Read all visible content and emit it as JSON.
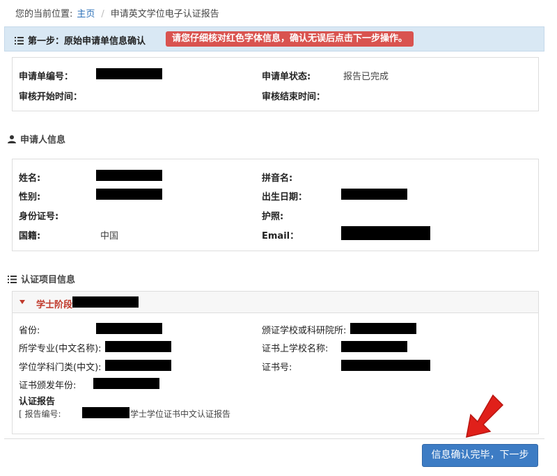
{
  "breadcrumb": {
    "prefix": "您的当前位置:",
    "home": "主页",
    "separator": "/",
    "current": "申请英文学位电子认证报告"
  },
  "step": {
    "title": "第一步：原始申请单信息确认",
    "warning": "请您仔细核对红色字体信息，确认无误后点击下一步操作。"
  },
  "application": {
    "number_label": "申请单编号：",
    "status_label": "申请单状态:",
    "status_value": "报告已完成",
    "review_start_label": "审核开始时间：",
    "review_end_label": "审核结束时间："
  },
  "applicant": {
    "section_title": "申请人信息",
    "name_label": "姓名:",
    "pinyin_label": "拼音名:",
    "gender_label": "性别:",
    "birth_label": "出生日期：",
    "id_label": "身份证号:",
    "passport_label": "护照:",
    "nationality_label": "国籍:",
    "nationality_value": "中国",
    "email_label": "Email："
  },
  "certification": {
    "section_title": "认证项目信息",
    "stage_label": "学士阶段",
    "province_label": "省份:",
    "school_label": "颁证学校或科研院所:",
    "major_label": "所学专业(中文名称):",
    "cert_school_label": "证书上学校名称:",
    "category_label": "学位学科门类(中文):",
    "cert_no_label": "证书号:",
    "year_label": "证书颁发年份:",
    "report_title": "认证报告",
    "report_prefix": "[ 报告编号:",
    "report_suffix": "学士学位证书中文认证报告"
  },
  "actions": {
    "next_label": "信息确认完毕，下一步"
  },
  "colors": {
    "link": "#2a6fb8",
    "warning_bg": "#d9534f",
    "stage_text": "#c0392b",
    "button_bg": "#3d7cc4",
    "arrow": "#e0201a"
  }
}
